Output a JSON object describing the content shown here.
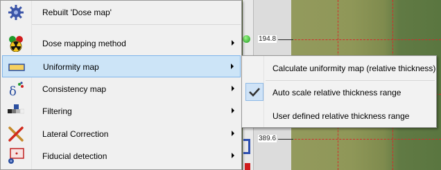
{
  "background": {
    "tick_labels": [
      "194.8",
      "389.6"
    ]
  },
  "context_menu": {
    "items": [
      {
        "label": "Rebuilt 'Dose map'",
        "icon": "gear-icon",
        "has_submenu": false,
        "highlighted": false
      },
      {
        "label": "Dose mapping method",
        "icon": "radiation-icon",
        "has_submenu": true,
        "highlighted": false
      },
      {
        "label": "Uniformity map",
        "icon": "uniformity-bar-icon",
        "has_submenu": true,
        "highlighted": true
      },
      {
        "label": "Consistency map",
        "icon": "delta-icon",
        "has_submenu": true,
        "highlighted": false
      },
      {
        "label": "Filtering",
        "icon": "filter-blocks-icon",
        "has_submenu": true,
        "highlighted": false
      },
      {
        "label": "Lateral Correction",
        "icon": "cross-pens-icon",
        "has_submenu": true,
        "highlighted": false
      },
      {
        "label": "Fiducial detection",
        "icon": "fiducial-icon",
        "has_submenu": true,
        "highlighted": false
      }
    ]
  },
  "submenu": {
    "items": [
      {
        "label": "Calculate uniformity map (relative thickness)",
        "checked": false
      },
      {
        "label": "Auto scale relative thickness range",
        "checked": true
      },
      {
        "label": "User defined relative thickness range",
        "checked": false
      }
    ]
  },
  "colors": {
    "highlight": "#cce4f7",
    "highlight_border": "#7eb4ea",
    "grid_line": "#d42a2a",
    "map_green": "#8f9758"
  }
}
